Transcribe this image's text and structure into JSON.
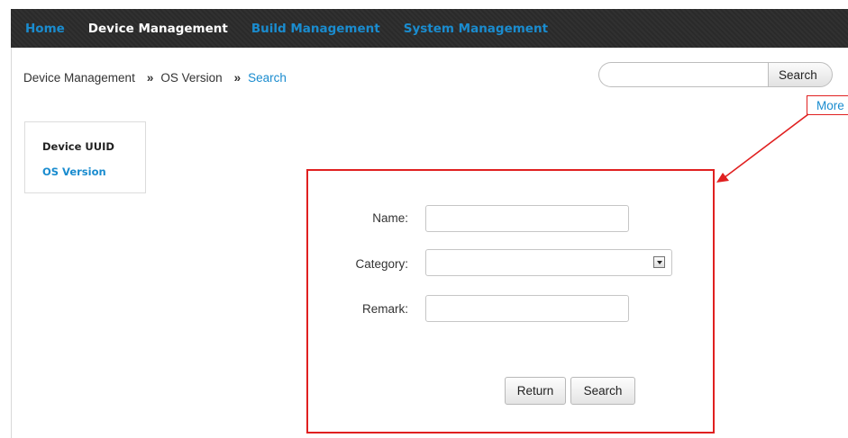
{
  "nav": {
    "items": [
      {
        "label": "Home",
        "active": false
      },
      {
        "label": "Device Management",
        "active": true
      },
      {
        "label": "Build Management",
        "active": false
      },
      {
        "label": "System Management",
        "active": false
      }
    ]
  },
  "breadcrumb": {
    "items": [
      "Device Management",
      "OS Version",
      "Search"
    ],
    "separator": "»"
  },
  "global_search": {
    "value": "",
    "placeholder": "",
    "button_label": "Search",
    "more_label": "More"
  },
  "sidebar": {
    "items": [
      {
        "label": "Device UUID",
        "active": false
      },
      {
        "label": "OS Version",
        "active": true
      }
    ]
  },
  "form": {
    "name_label": "Name:",
    "name_value": "",
    "category_label": "Category:",
    "category_selected": "",
    "remark_label": "Remark:",
    "remark_value": "",
    "return_label": "Return",
    "search_label": "Search"
  },
  "colors": {
    "accent": "#1a8ccf",
    "nav_bg": "#2a2a2a",
    "annotation": "#e02020"
  }
}
